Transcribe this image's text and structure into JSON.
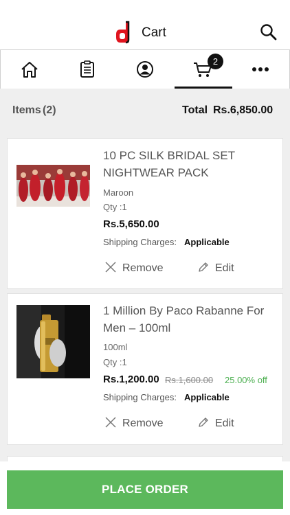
{
  "header": {
    "title": "Cart",
    "logo_icon": "d-logo-icon",
    "search_icon": "search-icon"
  },
  "nav": {
    "items": [
      {
        "icon": "home-icon"
      },
      {
        "icon": "orders-clipboard-icon"
      },
      {
        "icon": "account-icon"
      },
      {
        "icon": "cart-icon",
        "active": true
      },
      {
        "icon": "more-dots-icon"
      }
    ],
    "cart_badge": "2"
  },
  "summary": {
    "items_label": "Items",
    "items_count": "(2)",
    "total_label": "Total",
    "total_value": "Rs.6,850.00"
  },
  "cart_items": [
    {
      "title": "10 PC SILK BRIDAL SET NIGHTWEAR PACK",
      "variant": "Maroon",
      "qty": "Qty :1",
      "price": "Rs.5,650.00",
      "shipping_label": "Shipping Charges:",
      "shipping_value": "Applicable",
      "remove_label": "Remove",
      "edit_label": "Edit"
    },
    {
      "title": "1 Million By Paco Rabanne For Men – 100ml",
      "variant": "100ml",
      "qty": "Qty :1",
      "price": "Rs.1,200.00",
      "old_price": "Rs.1,600.00",
      "discount": "25.00% off",
      "shipping_label": "Shipping Charges:",
      "shipping_value": "Applicable",
      "remove_label": "Remove",
      "edit_label": "Edit"
    }
  ],
  "place_order_label": "PLACE ORDER",
  "colors": {
    "accent_green": "#5cb85c",
    "discount_green": "#4caf50",
    "logo_red": "#e0151f"
  }
}
